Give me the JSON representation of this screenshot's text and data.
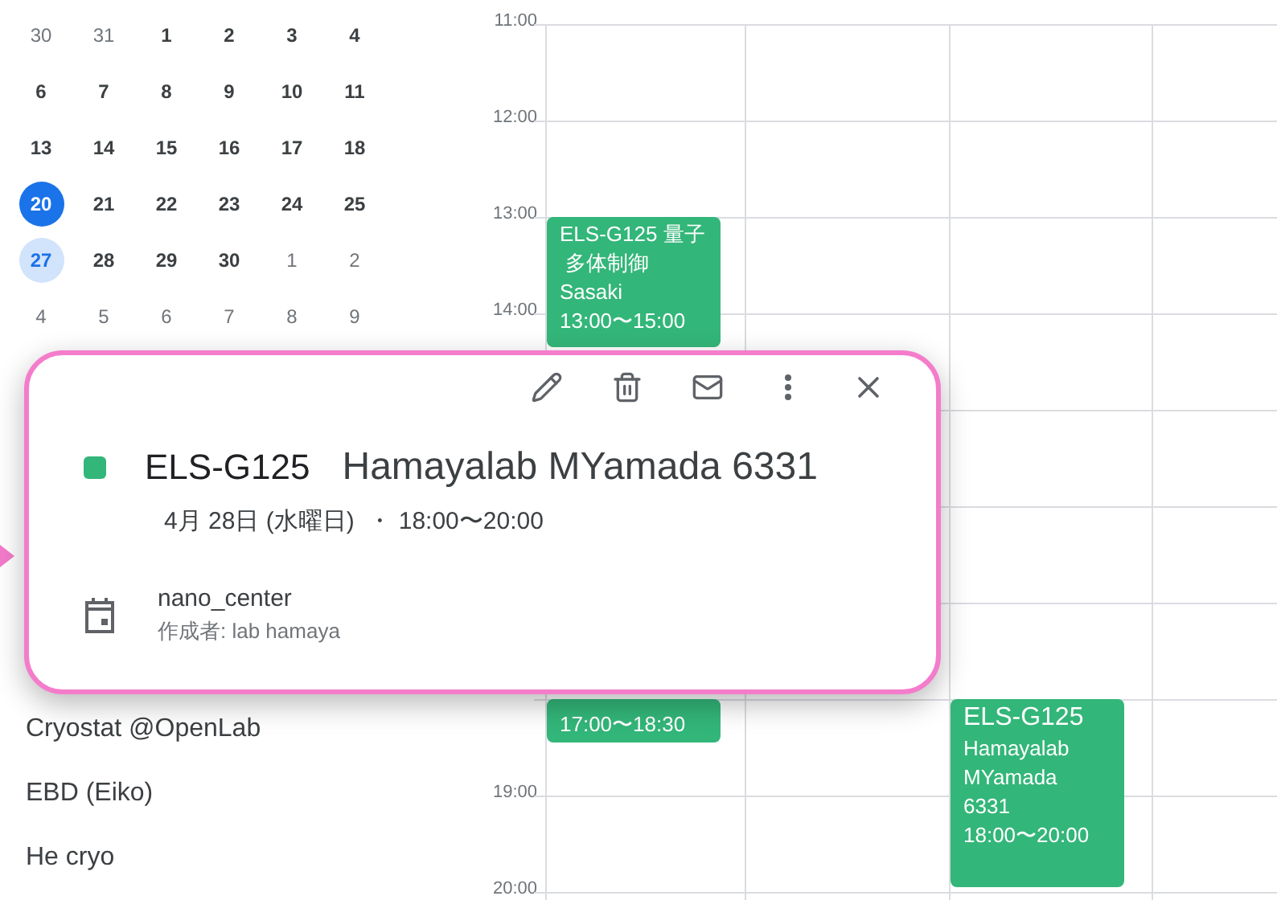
{
  "mini_calendar": {
    "weeks": [
      [
        {
          "day": "30",
          "muted": true,
          "today": false,
          "selected": false
        },
        {
          "day": "31",
          "muted": true,
          "today": false,
          "selected": false
        },
        {
          "day": "1",
          "muted": false,
          "today": false,
          "selected": false
        },
        {
          "day": "2",
          "muted": false,
          "today": false,
          "selected": false
        },
        {
          "day": "3",
          "muted": false,
          "today": false,
          "selected": false
        },
        {
          "day": "4",
          "muted": false,
          "today": false,
          "selected": false
        }
      ],
      [
        {
          "day": "6",
          "muted": false,
          "today": false,
          "selected": false
        },
        {
          "day": "7",
          "muted": false,
          "today": false,
          "selected": false
        },
        {
          "day": "8",
          "muted": false,
          "today": false,
          "selected": false
        },
        {
          "day": "9",
          "muted": false,
          "today": false,
          "selected": false
        },
        {
          "day": "10",
          "muted": false,
          "today": false,
          "selected": false
        },
        {
          "day": "11",
          "muted": false,
          "today": false,
          "selected": false
        }
      ],
      [
        {
          "day": "13",
          "muted": false,
          "today": false,
          "selected": false
        },
        {
          "day": "14",
          "muted": false,
          "today": false,
          "selected": false
        },
        {
          "day": "15",
          "muted": false,
          "today": false,
          "selected": false
        },
        {
          "day": "16",
          "muted": false,
          "today": false,
          "selected": false
        },
        {
          "day": "17",
          "muted": false,
          "today": false,
          "selected": false
        },
        {
          "day": "18",
          "muted": false,
          "today": false,
          "selected": false
        }
      ],
      [
        {
          "day": "20",
          "muted": false,
          "today": true,
          "selected": false
        },
        {
          "day": "21",
          "muted": false,
          "today": false,
          "selected": false
        },
        {
          "day": "22",
          "muted": false,
          "today": false,
          "selected": false
        },
        {
          "day": "23",
          "muted": false,
          "today": false,
          "selected": false
        },
        {
          "day": "24",
          "muted": false,
          "today": false,
          "selected": false
        },
        {
          "day": "25",
          "muted": false,
          "today": false,
          "selected": false
        }
      ],
      [
        {
          "day": "27",
          "muted": false,
          "today": false,
          "selected": true
        },
        {
          "day": "28",
          "muted": false,
          "today": false,
          "selected": false
        },
        {
          "day": "29",
          "muted": false,
          "today": false,
          "selected": false
        },
        {
          "day": "30",
          "muted": false,
          "today": false,
          "selected": false
        },
        {
          "day": "1",
          "muted": true,
          "today": false,
          "selected": false
        },
        {
          "day": "2",
          "muted": true,
          "today": false,
          "selected": false
        }
      ],
      [
        {
          "day": "4",
          "muted": true,
          "today": false,
          "selected": false
        },
        {
          "day": "5",
          "muted": true,
          "today": false,
          "selected": false
        },
        {
          "day": "6",
          "muted": true,
          "today": false,
          "selected": false
        },
        {
          "day": "7",
          "muted": true,
          "today": false,
          "selected": false
        },
        {
          "day": "8",
          "muted": true,
          "today": false,
          "selected": false
        },
        {
          "day": "9",
          "muted": true,
          "today": false,
          "selected": false
        }
      ]
    ]
  },
  "calendars": [
    "Cryostat @OpenLab",
    "EBD (Eiko)",
    "He cryo"
  ],
  "time_labels": [
    "11:00",
    "12:00",
    "13:00",
    "14:00",
    "19:00",
    "20:00"
  ],
  "events": [
    {
      "color": "#33b679",
      "lines": [
        "ELS-G125 量子",
        " 多体制御",
        "Sasaki",
        "13:00〜15:00"
      ]
    },
    {
      "color": "#33b679",
      "lines": [
        "17:00〜18:30"
      ]
    },
    {
      "color": "#33b679",
      "title": "ELS-G125",
      "lines": [
        "Hamayalab",
        "MYamada",
        "6331",
        "18:00〜20:00"
      ]
    }
  ],
  "popup": {
    "color": "#33b679",
    "code": "ELS-G125",
    "title": "Hamayalab MYamada 6331",
    "when": "4月 28日 (水曜日)  ・ 18:00〜20:00",
    "calendar": "nano_center",
    "creator": "作成者: lab hamaya"
  }
}
